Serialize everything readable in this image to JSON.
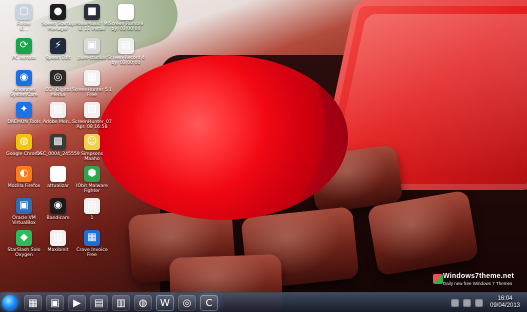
{
  "desktop": {
    "icons": [
      {
        "name": "desktop-icon-1",
        "label": "Folder\nIE...",
        "glyph": "▢",
        "color": "#c9d3dd"
      },
      {
        "name": "desktop-icon-2",
        "label": "Speed Startup\nManager",
        "glyph": "●",
        "color": "#1e1e1e"
      },
      {
        "name": "desktop-icon-3",
        "label": "MakeMusic! MI\nIE 11 Install",
        "glyph": "■",
        "color": "#2b2f3b"
      },
      {
        "name": "desktop-icon-4",
        "label": "Screen Rumble\nby: 03:00:00",
        "glyph": "◆",
        "color": "#ffffff"
      },
      {
        "name": "desktop-icon-5",
        "label": "PC remote",
        "glyph": "⟳",
        "color": "#18a44a"
      },
      {
        "name": "desktop-icon-6",
        "label": "Speed Edit",
        "glyph": "⚡",
        "color": "#1f2a3d"
      },
      {
        "name": "desktop-icon-7",
        "label": "pure-studios",
        "glyph": "▣",
        "color": "#d9d9d9"
      },
      {
        "name": "desktop-icon-8",
        "label": "Screen-Record 4\nby: 03:00:00",
        "glyph": "▤",
        "color": "#f0f0f0"
      },
      {
        "name": "desktop-icon-9",
        "label": "Advanced\nSystemCare",
        "glyph": "◉",
        "color": "#1e6fe0"
      },
      {
        "name": "desktop-icon-10",
        "label": "CCX Digital\nMedia",
        "glyph": "◎",
        "color": "#2b2b2b"
      },
      {
        "name": "desktop-icon-11",
        "label": "ScreenHunter 5.1\nFree",
        "glyph": "▦",
        "color": "#f0f0f0"
      },
      {
        "name": "desktop-icon-12",
        "label": "DAEMON Tools",
        "glyph": "✦",
        "color": "#1a73e8"
      },
      {
        "name": "desktop-icon-13",
        "label": "Adobe Mon...",
        "glyph": "▨",
        "color": "#f0f0f0"
      },
      {
        "name": "desktop-icon-14",
        "label": "ScreenHunter_07\nApr. 08 16:58",
        "glyph": "▧",
        "color": "#f0f0f0"
      },
      {
        "name": "desktop-icon-15",
        "label": "Google Chrome",
        "glyph": "◍",
        "color": "#f1c40f"
      },
      {
        "name": "desktop-icon-16",
        "label": "DSC_0004_245559",
        "glyph": "▩",
        "color": "#3a3a3a"
      },
      {
        "name": "desktop-icon-17",
        "label": "Simpsons\nMaaho",
        "glyph": "☺",
        "color": "#f1d04b"
      },
      {
        "name": "desktop-icon-18",
        "label": "Mozilla Firefox",
        "glyph": "◐",
        "color": "#ff7b1b"
      },
      {
        "name": "desktop-icon-19",
        "label": "attualizar",
        "glyph": "▢",
        "color": "#ffffff"
      },
      {
        "name": "desktop-icon-20",
        "label": "IObit Malware\nFighter",
        "glyph": "⬢",
        "color": "#2ea44f"
      },
      {
        "name": "desktop-icon-21",
        "label": "Oracle VM\nVirtualBox",
        "glyph": "▣",
        "color": "#2b6fb5"
      },
      {
        "name": "desktop-icon-22",
        "label": "Bandicam",
        "glyph": "◉",
        "color": "#1b1b1b"
      },
      {
        "name": "desktop-icon-23",
        "label": "1",
        "glyph": "▤",
        "color": "#f0f0f0"
      },
      {
        "name": "desktop-icon-24",
        "label": "StarSlash Solo\nOxygen",
        "glyph": "◆",
        "color": "#2dbb5b"
      },
      {
        "name": "desktop-icon-25",
        "label": "Maxibinit",
        "glyph": "▥",
        "color": "#f0f0f0"
      },
      {
        "name": "desktop-icon-26",
        "label": "Crave Invoice\nFree",
        "glyph": "▦",
        "color": "#1d6fd6"
      }
    ]
  },
  "taskbar": {
    "start_label": "Start",
    "items": [
      {
        "name": "taskbar-item-1",
        "glyph": "▦",
        "active": false
      },
      {
        "name": "taskbar-item-2",
        "glyph": "▣",
        "active": false
      },
      {
        "name": "taskbar-item-3",
        "glyph": "▶",
        "active": false
      },
      {
        "name": "taskbar-item-4",
        "glyph": "▤",
        "active": false
      },
      {
        "name": "taskbar-item-5",
        "glyph": "▥",
        "active": false
      },
      {
        "name": "taskbar-item-6",
        "glyph": "◍",
        "active": false
      },
      {
        "name": "taskbar-item-7",
        "glyph": "W",
        "active": true
      },
      {
        "name": "taskbar-item-8",
        "glyph": "◎",
        "active": false
      },
      {
        "name": "taskbar-item-9",
        "glyph": "C",
        "active": true
      }
    ],
    "clock": {
      "time": "16:04",
      "date": "09/04/2013"
    }
  },
  "branding": {
    "title": "Windows7theme.net",
    "subtitle": "Daily new free Windows 7 Themes"
  }
}
